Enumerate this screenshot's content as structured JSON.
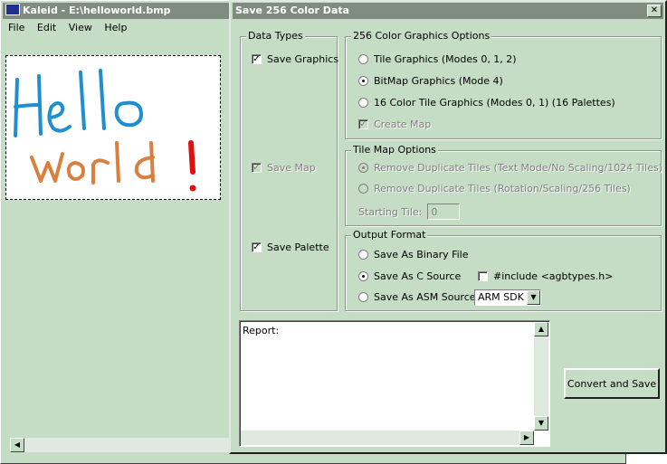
{
  "main_window": {
    "title": "Kaleid - E:\\helloworld.bmp",
    "menu": [
      "File",
      "Edit",
      "View",
      "Help"
    ]
  },
  "dialog": {
    "title": "Save 256 Color Data",
    "close": "✕",
    "data_types": {
      "legend": "Data Types",
      "save_graphics": "Save Graphics",
      "save_map": "Save Map",
      "save_palette": "Save Palette"
    },
    "graphics_options": {
      "legend": "256 Color Graphics Options",
      "tile": "Tile Graphics (Modes 0, 1, 2)",
      "bitmap": "BitMap Graphics (Mode 4)",
      "tile16": "16 Color Tile Graphics (Modes 0, 1) (16 Palettes)",
      "create_map": "Create Map"
    },
    "tile_map_options": {
      "legend": "Tile Map Options",
      "remove_text": "Remove Duplicate Tiles (Text Mode/No Scaling/1024 Tiles)",
      "remove_rot": "Remove Duplicate Tiles (Rotation/Scaling/256 Tiles)",
      "starting_tile_label": "Starting Tile:",
      "starting_tile_value": "0"
    },
    "output_format": {
      "legend": "Output Format",
      "binary": "Save As Binary File",
      "c_source": "Save As C Source",
      "asm_source": "Save As ASM Source",
      "include": "#include <agbtypes.h>",
      "asm_select": "ARM SDK"
    },
    "report_label": "Report:",
    "convert_button": "Convert and Save"
  },
  "colors": {
    "face": "#c5dcc5",
    "hello": "#1f8fd0",
    "world": "#d98040",
    "exclaim": "#e01010"
  }
}
